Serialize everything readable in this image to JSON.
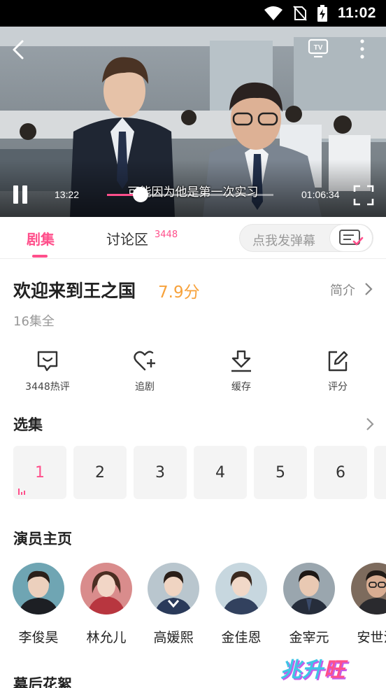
{
  "status_bar": {
    "time": "11:02"
  },
  "player": {
    "subtitle": "可能因为他是第一次实习",
    "current_time": "13:22",
    "total_time": "01:06:34",
    "progress_fraction": 0.2,
    "tv_label": "TV"
  },
  "tabs": {
    "episodes": "剧集",
    "discussion": "讨论区",
    "discussion_count": "3448",
    "danmu_placeholder": "点我发弹幕"
  },
  "show": {
    "title": "欢迎来到王之国",
    "score": "7.9分",
    "intro_label": "简介",
    "episodes_info": "16集全"
  },
  "actions": [
    {
      "label": "3448热评",
      "icon": "comment-smile-icon"
    },
    {
      "label": "追剧",
      "icon": "heart-plus-icon"
    },
    {
      "label": "缓存",
      "icon": "download-icon"
    },
    {
      "label": "评分",
      "icon": "edit-icon"
    }
  ],
  "episode_section": {
    "title": "选集",
    "episodes": [
      "1",
      "2",
      "3",
      "4",
      "5",
      "6"
    ],
    "active": "1"
  },
  "cast_section": {
    "title": "演员主页",
    "actors": [
      {
        "name": "李俊昊"
      },
      {
        "name": "林允儿"
      },
      {
        "name": "高媛熙"
      },
      {
        "name": "金佳恩"
      },
      {
        "name": "金宰元"
      },
      {
        "name": "安世浩"
      }
    ]
  },
  "behind_section": {
    "title": "幕后花絮"
  },
  "watermark": {
    "part1": "兆升",
    "part2": "旺"
  },
  "colors": {
    "accent": "#ff4f8b",
    "score": "#f7a23b",
    "status_bar": "#000000"
  }
}
